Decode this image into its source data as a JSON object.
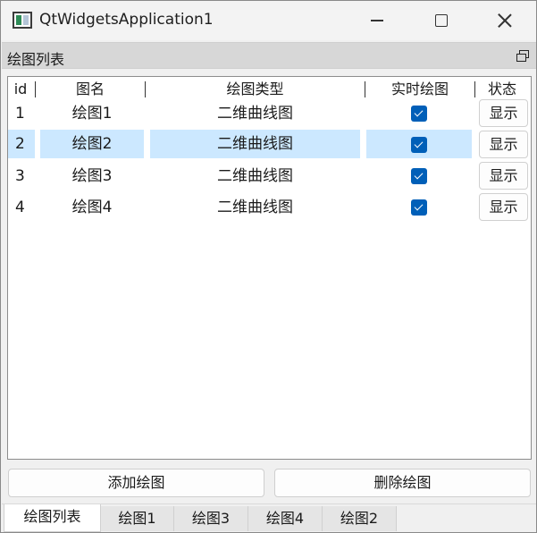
{
  "window": {
    "title": "QtWidgetsApplication1"
  },
  "dock": {
    "title": "绘图列表"
  },
  "table": {
    "headers": [
      "id",
      "图名",
      "绘图类型",
      "实时绘图",
      "状态"
    ],
    "rows": [
      {
        "id": "1",
        "name": "绘图1",
        "type": "二维曲线图",
        "realtime": true,
        "button": "显示"
      },
      {
        "id": "2",
        "name": "绘图2",
        "type": "二维曲线图",
        "realtime": true,
        "button": "显示",
        "selected": true
      },
      {
        "id": "3",
        "name": "绘图3",
        "type": "二维曲线图",
        "realtime": true,
        "button": "显示"
      },
      {
        "id": "4",
        "name": "绘图4",
        "type": "二维曲线图",
        "realtime": true,
        "button": "显示"
      }
    ]
  },
  "actions": {
    "add_label": "添加绘图",
    "delete_label": "删除绘图"
  },
  "tabs": [
    "绘图列表",
    "绘图1",
    "绘图3",
    "绘图4",
    "绘图2"
  ],
  "colors": {
    "selection": "#cce8ff",
    "checkbox": "#005fb8"
  }
}
